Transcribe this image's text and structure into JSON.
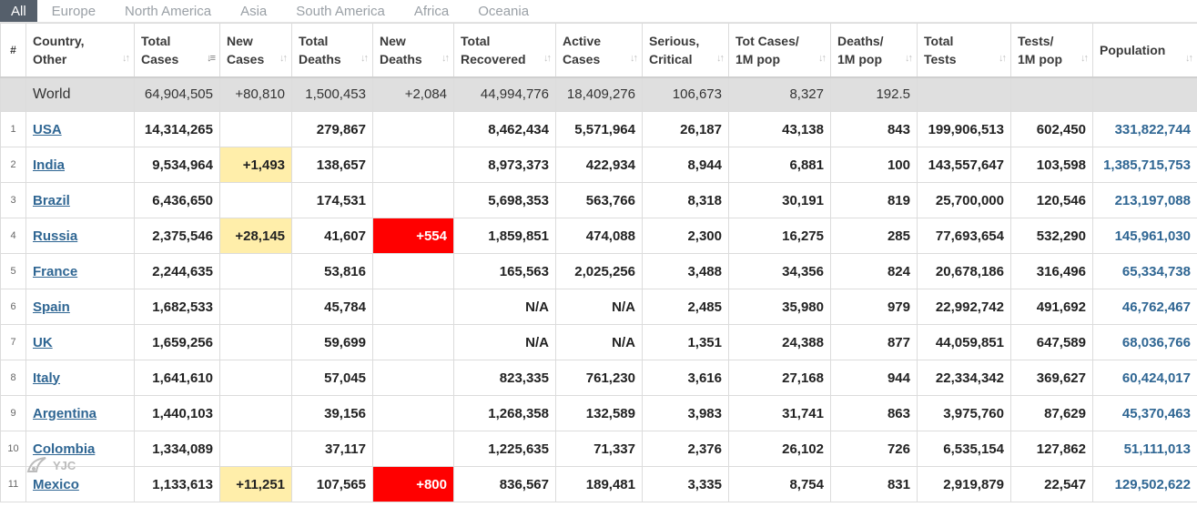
{
  "tabs": [
    "All",
    "Europe",
    "North America",
    "Asia",
    "South America",
    "Africa",
    "Oceania"
  ],
  "headers": {
    "idx": "#",
    "country": [
      "Country,",
      "Other"
    ],
    "total_cases": [
      "Total",
      "Cases"
    ],
    "new_cases": [
      "New",
      "Cases"
    ],
    "total_deaths": [
      "Total",
      "Deaths"
    ],
    "new_deaths": [
      "New",
      "Deaths"
    ],
    "total_recovered": [
      "Total",
      "Recovered"
    ],
    "active_cases": [
      "Active",
      "Cases"
    ],
    "serious": [
      "Serious,",
      "Critical"
    ],
    "cases_per_m": [
      "Tot Cases/",
      "1M pop"
    ],
    "deaths_per_m": [
      "Deaths/",
      "1M pop"
    ],
    "total_tests": [
      "Total",
      "Tests"
    ],
    "tests_per_m": [
      "Tests/",
      "1M pop"
    ],
    "population": [
      "Population",
      ""
    ]
  },
  "world": {
    "name": "World",
    "total_cases": "64,904,505",
    "new_cases": "+80,810",
    "total_deaths": "1,500,453",
    "new_deaths": "+2,084",
    "total_recovered": "44,994,776",
    "active_cases": "18,409,276",
    "serious": "106,673",
    "cases_per_m": "8,327",
    "deaths_per_m": "192.5",
    "total_tests": "",
    "tests_per_m": "",
    "population": ""
  },
  "rows": [
    {
      "idx": "1",
      "name": "USA",
      "total_cases": "14,314,265",
      "new_cases": "",
      "total_deaths": "279,867",
      "new_deaths": "",
      "total_recovered": "8,462,434",
      "active_cases": "5,571,964",
      "serious": "26,187",
      "cases_per_m": "43,138",
      "deaths_per_m": "843",
      "total_tests": "199,906,513",
      "tests_per_m": "602,450",
      "population": "331,822,744"
    },
    {
      "idx": "2",
      "name": "India",
      "total_cases": "9,534,964",
      "new_cases": "+1,493",
      "total_deaths": "138,657",
      "new_deaths": "",
      "total_recovered": "8,973,373",
      "active_cases": "422,934",
      "serious": "8,944",
      "cases_per_m": "6,881",
      "deaths_per_m": "100",
      "total_tests": "143,557,647",
      "tests_per_m": "103,598",
      "population": "1,385,715,753"
    },
    {
      "idx": "3",
      "name": "Brazil",
      "total_cases": "6,436,650",
      "new_cases": "",
      "total_deaths": "174,531",
      "new_deaths": "",
      "total_recovered": "5,698,353",
      "active_cases": "563,766",
      "serious": "8,318",
      "cases_per_m": "30,191",
      "deaths_per_m": "819",
      "total_tests": "25,700,000",
      "tests_per_m": "120,546",
      "population": "213,197,088"
    },
    {
      "idx": "4",
      "name": "Russia",
      "total_cases": "2,375,546",
      "new_cases": "+28,145",
      "total_deaths": "41,607",
      "new_deaths": "+554",
      "total_recovered": "1,859,851",
      "active_cases": "474,088",
      "serious": "2,300",
      "cases_per_m": "16,275",
      "deaths_per_m": "285",
      "total_tests": "77,693,654",
      "tests_per_m": "532,290",
      "population": "145,961,030"
    },
    {
      "idx": "5",
      "name": "France",
      "total_cases": "2,244,635",
      "new_cases": "",
      "total_deaths": "53,816",
      "new_deaths": "",
      "total_recovered": "165,563",
      "active_cases": "2,025,256",
      "serious": "3,488",
      "cases_per_m": "34,356",
      "deaths_per_m": "824",
      "total_tests": "20,678,186",
      "tests_per_m": "316,496",
      "population": "65,334,738"
    },
    {
      "idx": "6",
      "name": "Spain",
      "total_cases": "1,682,533",
      "new_cases": "",
      "total_deaths": "45,784",
      "new_deaths": "",
      "total_recovered": "N/A",
      "active_cases": "N/A",
      "serious": "2,485",
      "cases_per_m": "35,980",
      "deaths_per_m": "979",
      "total_tests": "22,992,742",
      "tests_per_m": "491,692",
      "population": "46,762,467"
    },
    {
      "idx": "7",
      "name": "UK",
      "total_cases": "1,659,256",
      "new_cases": "",
      "total_deaths": "59,699",
      "new_deaths": "",
      "total_recovered": "N/A",
      "active_cases": "N/A",
      "serious": "1,351",
      "cases_per_m": "24,388",
      "deaths_per_m": "877",
      "total_tests": "44,059,851",
      "tests_per_m": "647,589",
      "population": "68,036,766"
    },
    {
      "idx": "8",
      "name": "Italy",
      "total_cases": "1,641,610",
      "new_cases": "",
      "total_deaths": "57,045",
      "new_deaths": "",
      "total_recovered": "823,335",
      "active_cases": "761,230",
      "serious": "3,616",
      "cases_per_m": "27,168",
      "deaths_per_m": "944",
      "total_tests": "22,334,342",
      "tests_per_m": "369,627",
      "population": "60,424,017"
    },
    {
      "idx": "9",
      "name": "Argentina",
      "total_cases": "1,440,103",
      "new_cases": "",
      "total_deaths": "39,156",
      "new_deaths": "",
      "total_recovered": "1,268,358",
      "active_cases": "132,589",
      "serious": "3,983",
      "cases_per_m": "31,741",
      "deaths_per_m": "863",
      "total_tests": "3,975,760",
      "tests_per_m": "87,629",
      "population": "45,370,463"
    },
    {
      "idx": "10",
      "name": "Colombia",
      "total_cases": "1,334,089",
      "new_cases": "",
      "total_deaths": "37,117",
      "new_deaths": "",
      "total_recovered": "1,225,635",
      "active_cases": "71,337",
      "serious": "2,376",
      "cases_per_m": "26,102",
      "deaths_per_m": "726",
      "total_tests": "6,535,154",
      "tests_per_m": "127,862",
      "population": "51,111,013"
    },
    {
      "idx": "11",
      "name": "Mexico",
      "total_cases": "1,133,613",
      "new_cases": "+11,251",
      "total_deaths": "107,565",
      "new_deaths": "+800",
      "total_recovered": "836,567",
      "active_cases": "189,481",
      "serious": "3,335",
      "cases_per_m": "8,754",
      "deaths_per_m": "831",
      "total_tests": "2,919,879",
      "tests_per_m": "22,547",
      "population": "129,502,622"
    }
  ],
  "watermark": "YJC",
  "colors": {
    "link": "#2f6693",
    "new_cases_bg": "#ffeeaa",
    "new_deaths_bg": "#ff0000",
    "tab_active_bg": "#555f6b",
    "world_bg": "#dfdfdf"
  }
}
